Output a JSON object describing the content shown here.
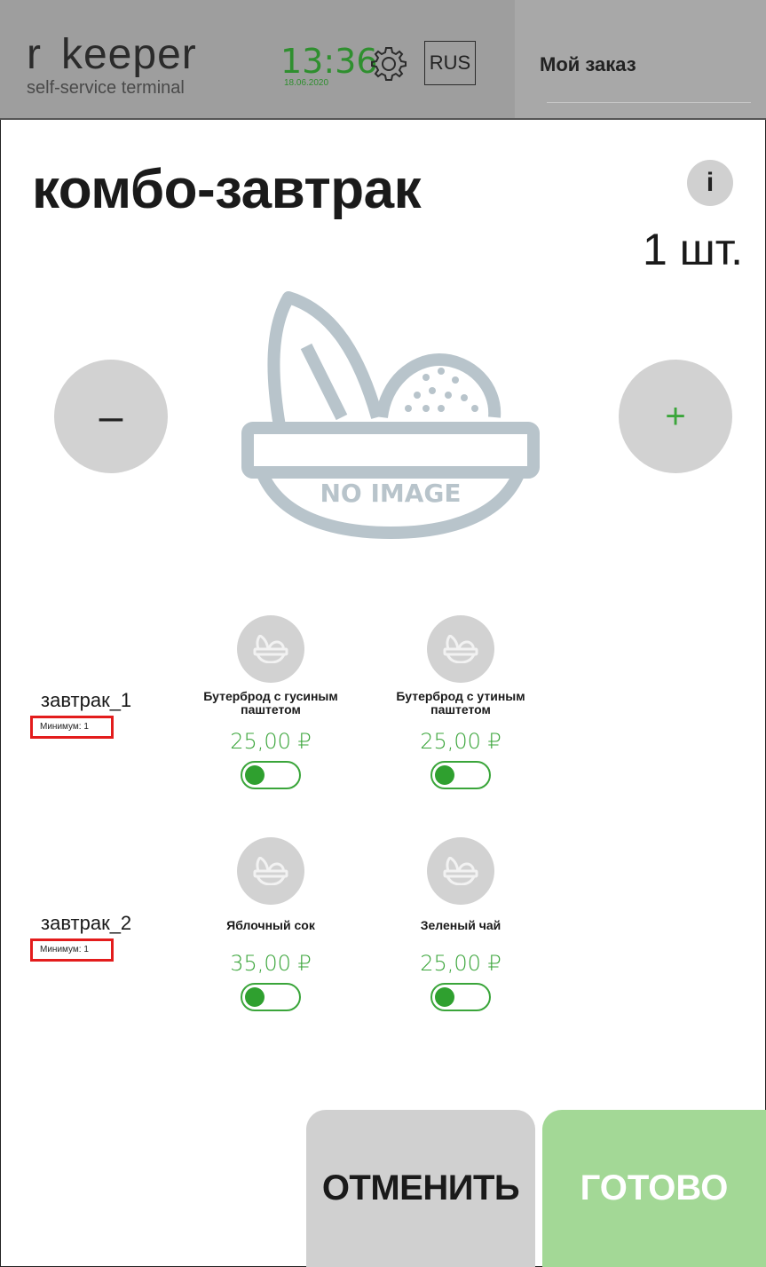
{
  "header": {
    "brand_name_r": "r",
    "brand_name_keeper": "keeper",
    "brand_sub": "self-service terminal",
    "time": "13:36",
    "date": "18.06.2020",
    "language": "RUS",
    "order_title": "Мой заказ",
    "settings_icon": "gear-icon"
  },
  "product": {
    "title": "комбо-завтрак",
    "info_label": "i",
    "quantity": "1 шт.",
    "minus_label": "–",
    "plus_label": "+",
    "image_text": "NO IMAGE"
  },
  "groups": [
    {
      "label": "завтрак_1",
      "minimum": "Минимум: 1",
      "options": [
        {
          "name": "Бутерброд с гусиным паштетом",
          "price": "25,00 ₽",
          "enabled": true
        },
        {
          "name": "Бутерброд с утиным паштетом",
          "price": "25,00 ₽",
          "enabled": true
        }
      ]
    },
    {
      "label": "завтрак_2",
      "minimum": "Минимум: 1",
      "options": [
        {
          "name": "Яблочный сок",
          "price": "35,00 ₽",
          "enabled": true
        },
        {
          "name": "Зеленый чай",
          "price": "25,00 ₽",
          "enabled": true
        }
      ]
    }
  ],
  "actions": {
    "cancel": "ОТМЕНИТЬ",
    "done": "ГОТОВО"
  },
  "colors": {
    "accent_green": "#3aa53a",
    "done_button": "#a3d896",
    "highlight_red": "#e31c1c",
    "header_gray": "#9e9e9e"
  }
}
